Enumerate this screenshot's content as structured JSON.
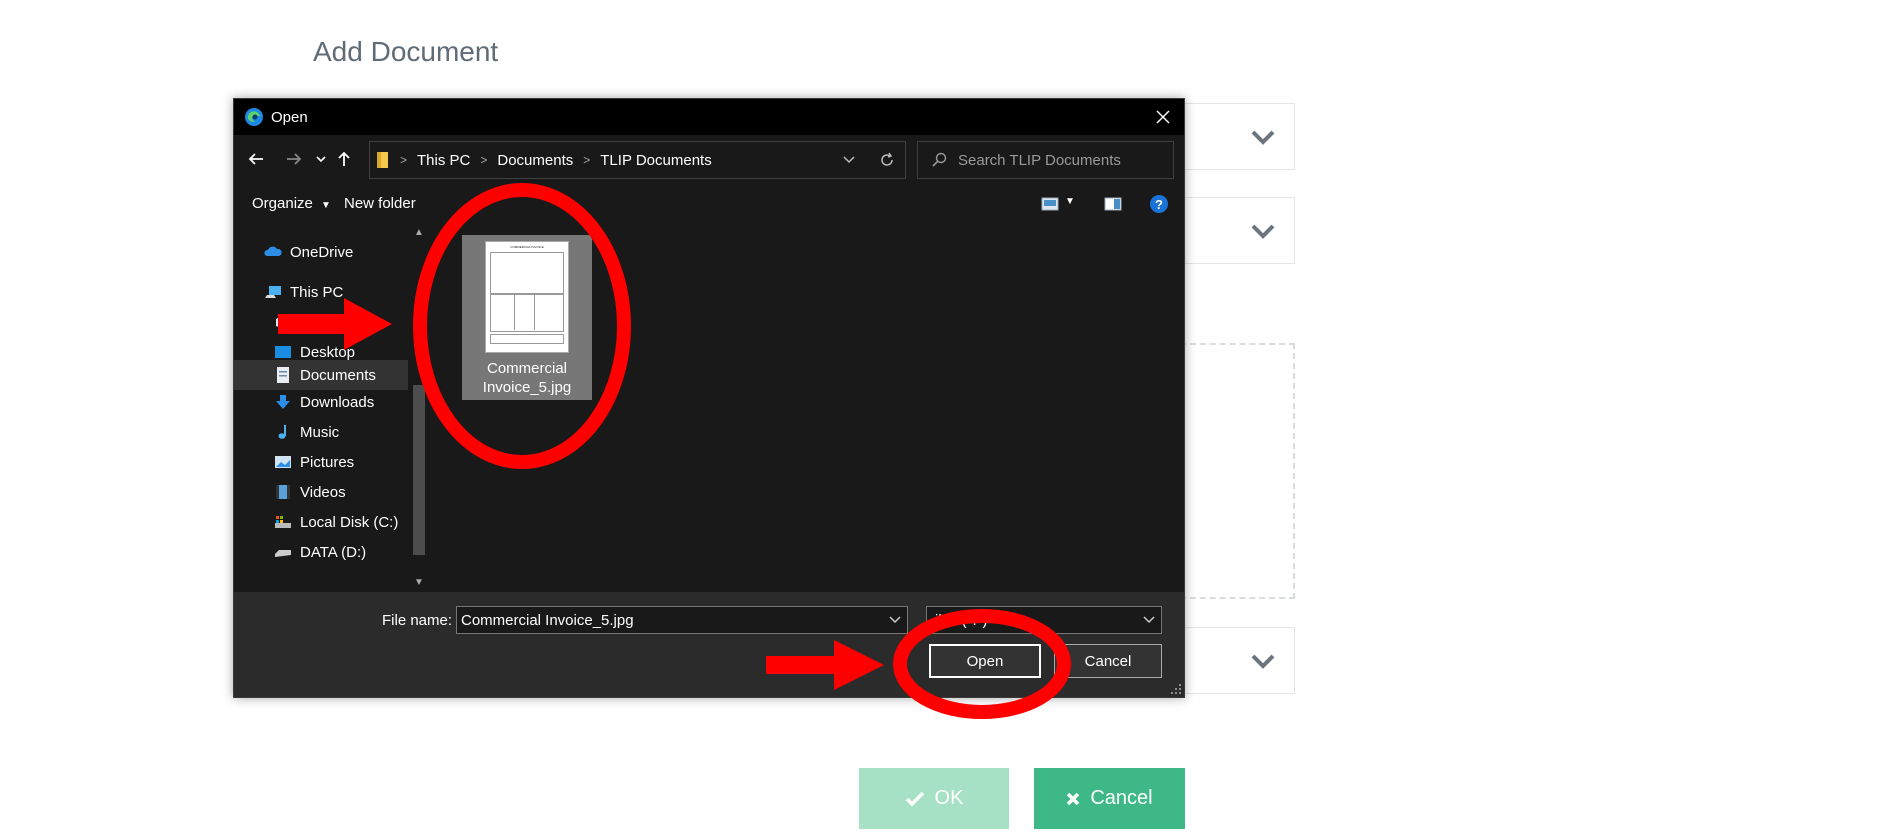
{
  "page": {
    "title": "Add Document",
    "ok_label": "OK",
    "cancel_label": "Cancel",
    "ok_icon": "check-icon",
    "cancel_icon": "x-icon"
  },
  "dialog": {
    "title": "Open",
    "breadcrumb": [
      "This PC",
      "Documents",
      "TLIP Documents"
    ],
    "search_placeholder": "Search TLIP Documents",
    "toolbar": {
      "organize": "Organize",
      "new_folder": "New folder"
    },
    "nav_items": [
      {
        "label": "OneDrive",
        "icon": "onedrive-icon"
      },
      {
        "label": "This PC",
        "icon": "this-pc-icon"
      },
      {
        "label": "",
        "icon": "3d-objects-icon"
      },
      {
        "label": "Desktop",
        "icon": "desktop-icon"
      },
      {
        "label": "Documents",
        "icon": "documents-icon"
      },
      {
        "label": "Downloads",
        "icon": "downloads-icon"
      },
      {
        "label": "Music",
        "icon": "music-icon"
      },
      {
        "label": "Pictures",
        "icon": "pictures-icon"
      },
      {
        "label": "Videos",
        "icon": "videos-icon"
      },
      {
        "label": "Local Disk (C:)",
        "icon": "local-disk-icon"
      },
      {
        "label": "DATA (D:)",
        "icon": "data-drive-icon"
      }
    ],
    "file": {
      "name_line1": "Commercial",
      "name_line2": "Invoice_5.jpg",
      "thumb_title": "COMMERCIAL INVOICE"
    },
    "file_name_label": "File name:",
    "file_name_value": "Commercial Invoice_5.jpg",
    "file_type_value": "iles (*.*)",
    "open_button": "Open",
    "cancel_button": "Cancel"
  },
  "colors": {
    "annotation_red": "#ff0000",
    "ok_green_disabled": "#a6e0c5",
    "cancel_green": "#3db886"
  }
}
